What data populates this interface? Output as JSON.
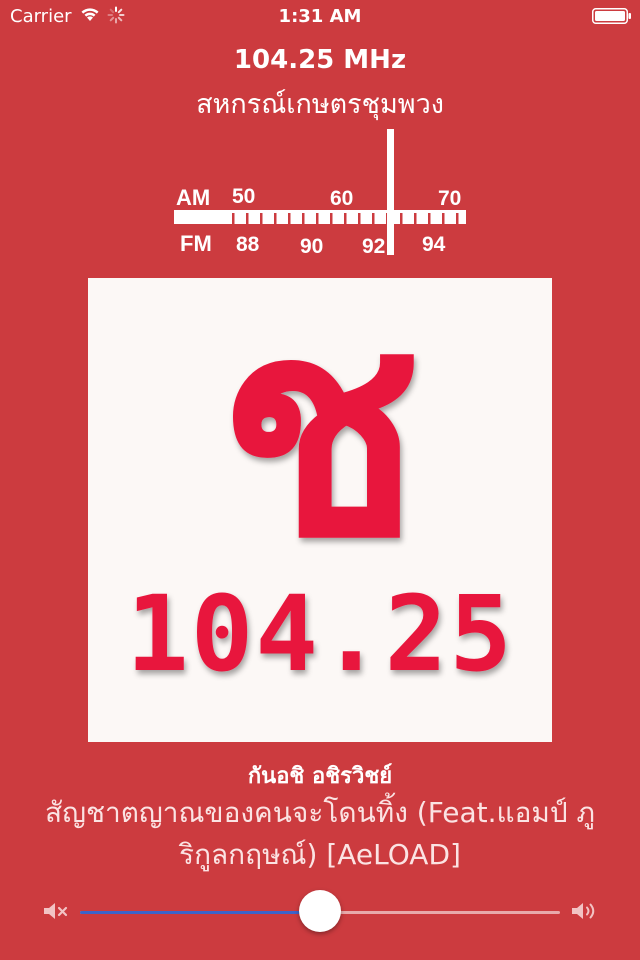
{
  "status_bar": {
    "carrier": "Carrier",
    "time": "1:31 AM",
    "battery_level": 1.0,
    "icons": [
      "wifi-icon",
      "activity-spinner-icon",
      "battery-icon"
    ]
  },
  "header": {
    "frequency": "104.25 MHz",
    "station": "สหกรณ์เกษตรชุมพวง"
  },
  "tuner": {
    "am_label": "AM",
    "fm_label": "FM",
    "am_ticks": [
      "50",
      "60",
      "70"
    ],
    "fm_ticks": [
      "88",
      "90",
      "92",
      "94"
    ]
  },
  "artwork": {
    "logo_char": "ช",
    "logo_freq": "104.25",
    "color": "#e8173c"
  },
  "track": {
    "artist": "กันอชิ อชิรวิชย์",
    "title": "สัญชาตญาณของคนจะโดนทิ้ง (Feat.แอมป์ ภูริกูลกฤษณ์) [AeLOAD]"
  },
  "volume": {
    "level": 0.5,
    "icons": [
      "volume-mute-icon",
      "volume-up-icon"
    ]
  },
  "colors": {
    "background": "#cc3b3f",
    "accent": "#3d63c9"
  }
}
